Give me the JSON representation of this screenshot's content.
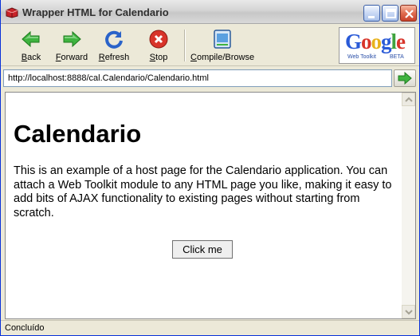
{
  "window": {
    "title": "Wrapper HTML for Calendario",
    "controls": {
      "minimize_icon": "minimize-icon",
      "maximize_icon": "maximize-icon",
      "close_icon": "close-icon"
    }
  },
  "toolbar": {
    "back_label": "Back",
    "forward_label": "Forward",
    "refresh_label": "Refresh",
    "stop_label": "Stop",
    "compile_label": "Compile/Browse",
    "logo": {
      "brand": "Google",
      "product": "Web Toolkit",
      "badge": "BETA"
    }
  },
  "address": {
    "url": "http://localhost:8888/cal.Calendario/Calendario.html",
    "go_icon": "go-arrow-icon"
  },
  "content": {
    "heading": "Calendario",
    "paragraph": "This is an example of a host page for the Calendario application. You can attach a Web Toolkit module to any HTML page you like, making it easy to add bits of AJAX functionality to existing pages without starting from scratch.",
    "button_label": "Click me"
  },
  "status": {
    "text": "Concluído"
  },
  "colors": {
    "arrow_green": "#3fb33f",
    "refresh_blue": "#2a63c9",
    "stop_red": "#d8342a",
    "title_text": "#303030"
  }
}
